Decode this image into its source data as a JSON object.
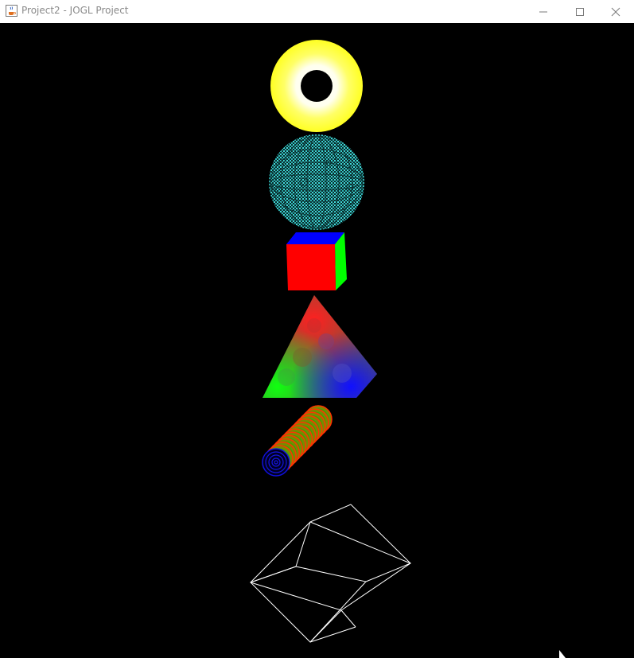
{
  "window": {
    "title": "Project2 - JOGL Project",
    "app_icon": "java-cup-icon",
    "controls": [
      "minimize-icon",
      "maximize-icon",
      "close-icon"
    ]
  },
  "scene": {
    "background": "#000000",
    "objects": [
      {
        "name": "torus",
        "color": "#ffff33",
        "inner_color": "#ffffff"
      },
      {
        "name": "sphere",
        "color": "#33cccc",
        "style": "wireframe-mesh"
      },
      {
        "name": "cube",
        "faces": [
          "#ff0000",
          "#00ff00",
          "#0000ff"
        ]
      },
      {
        "name": "pyramid",
        "colors": [
          "#ff0000",
          "#00ff00",
          "#0000ff"
        ]
      },
      {
        "name": "cylinder",
        "colors": [
          "#ff3300",
          "#33aa00",
          "#0000cc"
        ]
      },
      {
        "name": "wire-cube",
        "color": "#ffffff"
      }
    ]
  }
}
